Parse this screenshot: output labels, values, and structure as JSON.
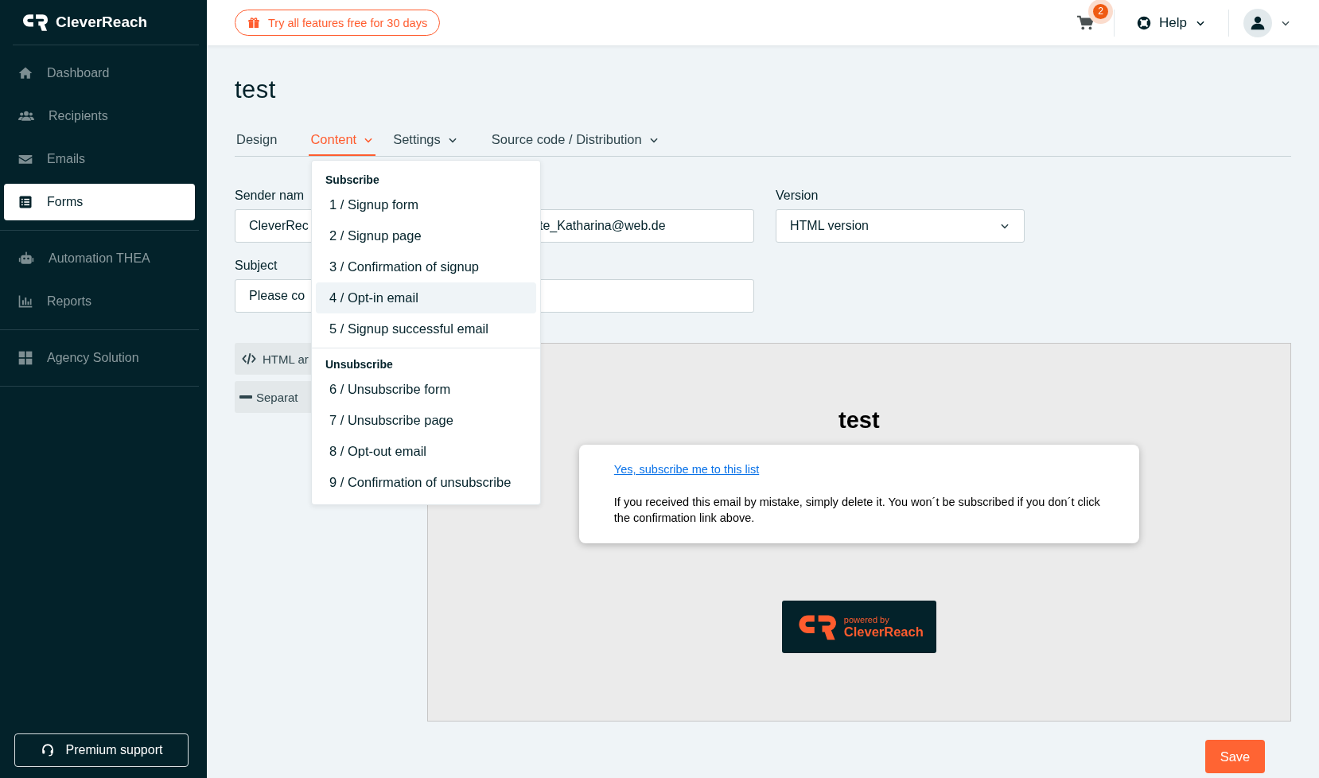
{
  "sidebar": {
    "logo": "CleverReach",
    "groups": [
      [
        {
          "label": "Dashboard",
          "selected": false
        },
        {
          "label": "Recipients",
          "selected": false
        },
        {
          "label": "Emails",
          "selected": false
        },
        {
          "label": "Forms",
          "selected": true
        }
      ],
      [
        {
          "label": "Automation THEA",
          "selected": false
        },
        {
          "label": "Reports",
          "selected": false
        }
      ],
      [
        {
          "label": "Agency Solution",
          "selected": false
        }
      ]
    ],
    "support_button": "Premium support"
  },
  "header": {
    "promo": "Try all features free for 30 days",
    "cart_badge": "2",
    "help": "Help"
  },
  "page": {
    "title": "test",
    "tabs": [
      {
        "label": "Design",
        "selected": false,
        "has_menu": false
      },
      {
        "label": "Content",
        "selected": true,
        "has_menu": true
      },
      {
        "label": "Settings",
        "selected": false,
        "has_menu": true
      },
      {
        "label": "Source code / Distribution",
        "selected": false,
        "has_menu": true
      }
    ]
  },
  "form": {
    "sender_name_label": "Sender nam",
    "sender_name_value": "CleverRec",
    "email_value": "te_Katharina@web.de",
    "version_label": "Version",
    "version_value": "HTML version",
    "subject_label": "Subject",
    "subject_value": "Please co"
  },
  "side_buttons": [
    {
      "label": "HTML ar"
    },
    {
      "label": "Separat"
    }
  ],
  "dropdown": {
    "sections": [
      {
        "heading": "Subscribe",
        "items": [
          {
            "label": "1 / Signup form",
            "selected": false
          },
          {
            "label": "2 / Signup page",
            "selected": false
          },
          {
            "label": "3 / Confirmation of signup",
            "selected": false
          },
          {
            "label": "4 / Opt-in email",
            "selected": true
          },
          {
            "label": "5 / Signup successful email",
            "selected": false
          }
        ]
      },
      {
        "heading": "Unsubscribe",
        "items": [
          {
            "label": "6 / Unsubscribe form",
            "selected": false
          },
          {
            "label": "7 / Unsubscribe page",
            "selected": false
          },
          {
            "label": "8 / Opt-out email",
            "selected": false
          },
          {
            "label": "9 / Confirmation of unsubscribe",
            "selected": false
          }
        ]
      }
    ]
  },
  "preview": {
    "heading": "test",
    "link": "Yes, subscribe me to this list",
    "text": "If you received this email by mistake, simply delete it. You won´t be subscribed if you don´t click the confirmation link above.",
    "badge_top": "powered by",
    "badge_brand": "CleverReach"
  },
  "save_button": "Save"
}
